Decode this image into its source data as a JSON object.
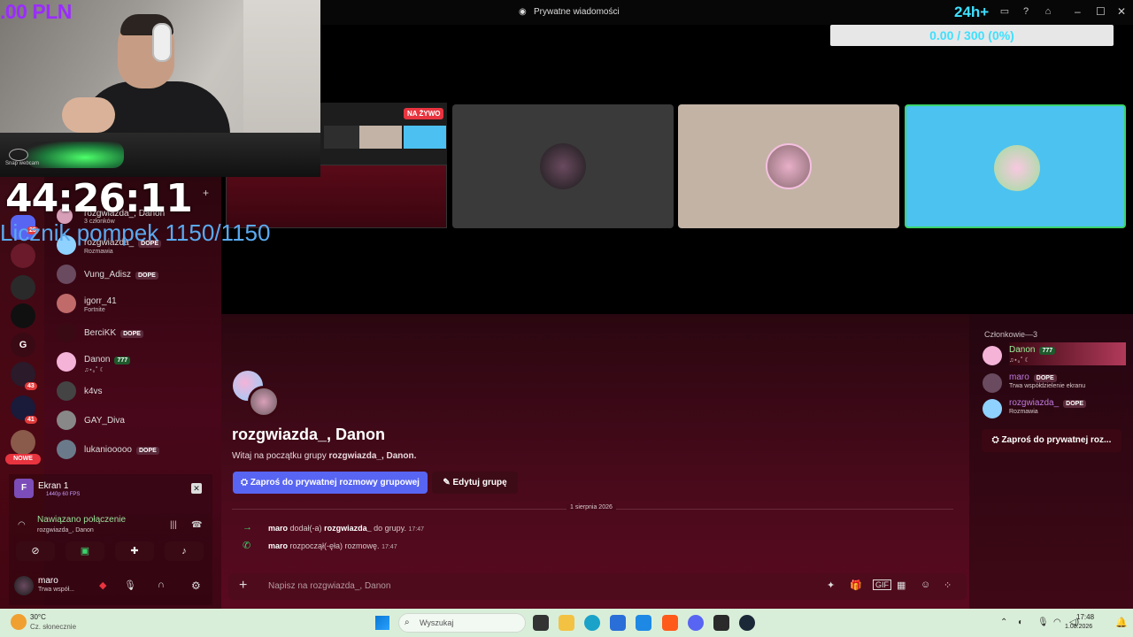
{
  "window": {
    "title": "Prywatne wiadomości",
    "hours_badge": "24h+",
    "counter_bar": "0.00 / 300 (0%)"
  },
  "overlay": {
    "pln": ".00 PLN",
    "timer": "44:26:11",
    "pushups": "Licznik pompek 1150/1150",
    "webcam_label": "Snap webcam",
    "live_badge": "NA ŻYWO"
  },
  "rail": {
    "badge_25": "25",
    "badge_43": "43",
    "badge_41": "41",
    "server_g": "G",
    "new_label": "NOWE"
  },
  "dm_list": {
    "header_name": "rozgwiazda_, Danon",
    "header_sub": "3 członków",
    "items": [
      {
        "name": "rozgwiazda_",
        "tag": "DOPE",
        "sub": "Rozmawia"
      },
      {
        "name": "Vung_Adisz",
        "tag": "DOPE",
        "sub": ""
      },
      {
        "name": "igorr_41",
        "tag": "",
        "sub": "Fortnite"
      },
      {
        "name": "BerciKK",
        "tag": "DOPE",
        "sub": ""
      },
      {
        "name": "Danon",
        "tag": "777",
        "sub": "♫⋆｡˚ ☾"
      },
      {
        "name": "k4vs",
        "tag": "",
        "sub": ""
      },
      {
        "name": "GAY_Diva",
        "tag": "",
        "sub": ""
      },
      {
        "name": "lukaniooooo",
        "tag": "DOPE",
        "sub": ""
      }
    ]
  },
  "voice": {
    "screen_title": "Ekran 1",
    "screen_sub": "1440p 60 FPS",
    "connected": "Nawiązano połączenie",
    "connected_sub": "rozgwiazda_, Danon",
    "user_name": "maro",
    "user_status": "Trwa współ..."
  },
  "chat": {
    "group_title": "rozgwiazda_, Danon",
    "welcome_prefix": "Witaj na początku grupy ",
    "welcome_name": "rozgwiazda_, Danon.",
    "invite_button": "Zaproś do prywatnej rozmowy grupowej",
    "edit_button": "Edytuj grupę",
    "date": "1 sierpnia 2026",
    "messages": [
      {
        "user": "maro",
        "action": "dodał(-a)",
        "target": "rozgwiazda_",
        "rest": "do grupy.",
        "time": "17:47"
      },
      {
        "user": "maro",
        "action": "rozpoczął(-ęła) rozmowę.",
        "target": "",
        "rest": "",
        "time": "17:47"
      }
    ],
    "composer_placeholder": "Napisz na rozgwiazda_, Danon"
  },
  "members": {
    "title": "Członkowie—3",
    "list": [
      {
        "name": "Danon",
        "tag": "777",
        "sub": "♫⋆｡˚ ☾",
        "color": "#9cf09c"
      },
      {
        "name": "maro",
        "tag": "DOPE",
        "sub": "Trwa współdzielenie ekranu",
        "color": "#c07adf"
      },
      {
        "name": "rozgwiazda_",
        "tag": "DOPE",
        "sub": "Rozmawia",
        "color": "#c07adf"
      }
    ],
    "invite": "Zaproś do prywatnej roz..."
  },
  "taskbar": {
    "temp": "30°C",
    "weather": "Cz. słonecznie",
    "search": "Wyszukaj",
    "time": "17:48",
    "date": "1.08.2026"
  },
  "colors": {
    "accent": "#5865f2",
    "counter": "#3fe0ff",
    "pushups": "#5aaaf0",
    "live": "#e8343f"
  }
}
